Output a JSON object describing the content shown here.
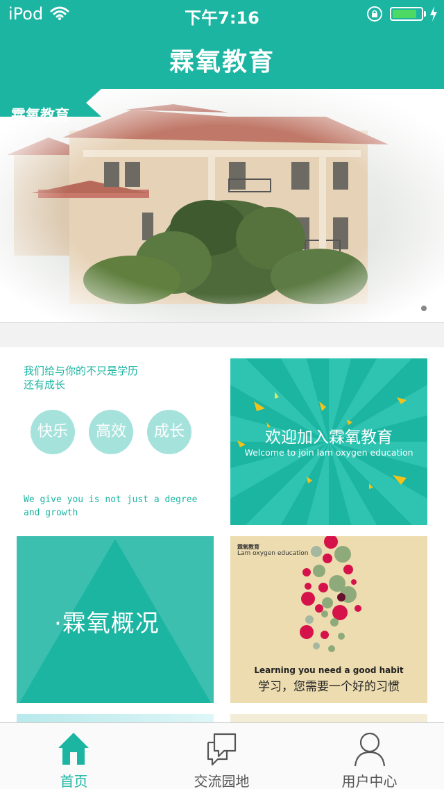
{
  "status_bar": {
    "carrier": "iPod",
    "time": "下午7:16",
    "battery_level": 0.85,
    "battery_color": "#4cd964"
  },
  "nav": {
    "title": "霖氧教育"
  },
  "banner": {
    "tag": "霖氧教育",
    "page_indicator": {
      "current": 1,
      "total": 1
    }
  },
  "cards": {
    "slogan": {
      "title_line1": "我们给与你的不只是学历",
      "title_line2": "还有成长",
      "bubbles": [
        "快乐",
        "高效",
        "成长"
      ],
      "english_line1": "We give you is not just a degree",
      "english_line2": "and growth"
    },
    "welcome": {
      "title": "欢迎加入霖氧教育",
      "subtitle": "Welcome to join lam oxygen education"
    },
    "overview": {
      "title": "·霖氧概况"
    },
    "habit": {
      "brand": "霖氧教育",
      "brand_en": "Lam oxygen education",
      "english": "Learning you need a good habit",
      "chinese": "学习，您需要一个好的习惯"
    }
  },
  "tabbar": {
    "items": [
      {
        "label": "首页",
        "icon": "home-icon",
        "active": true
      },
      {
        "label": "交流园地",
        "icon": "chat-bubbles-icon",
        "active": false
      },
      {
        "label": "用户中心",
        "icon": "user-icon",
        "active": false
      }
    ]
  },
  "colors": {
    "brand": "#1bb5a2",
    "bubble": "#a6e2dc",
    "habit_bg": "#ecdcb0"
  }
}
